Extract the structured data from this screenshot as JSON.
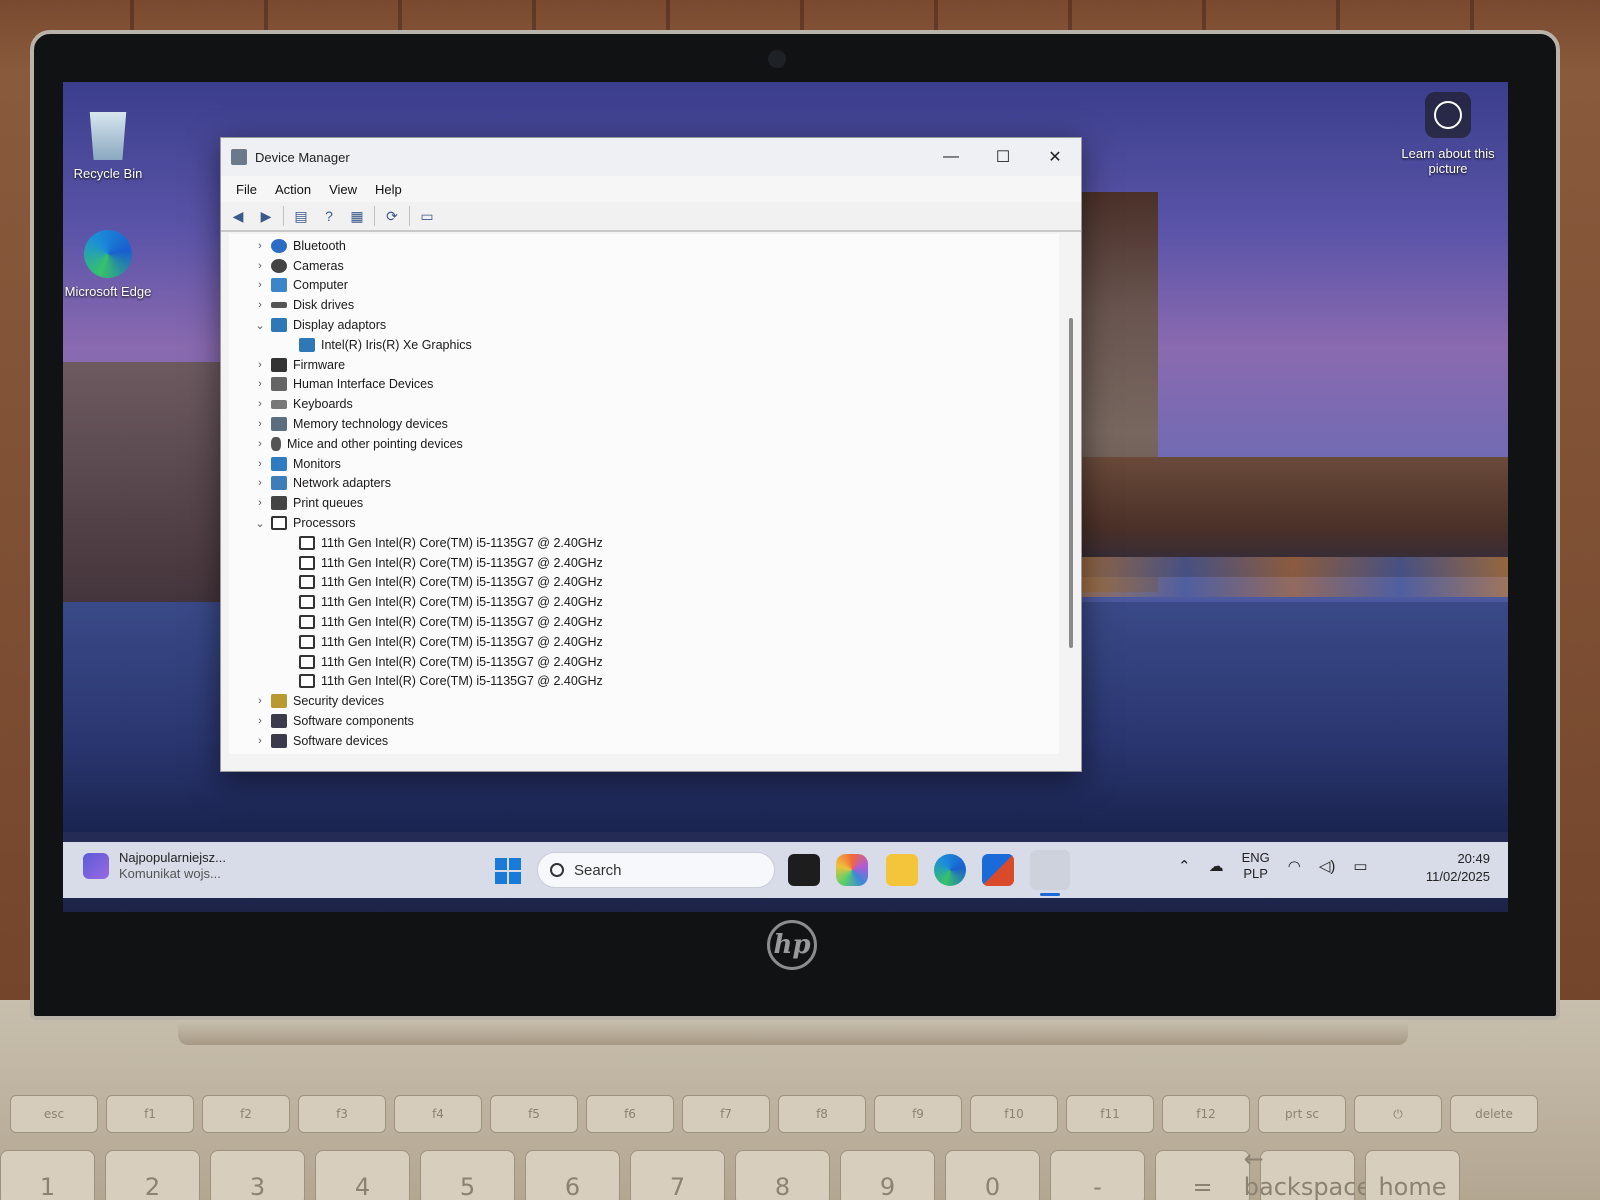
{
  "desktop": {
    "icons": [
      {
        "label": "Recycle Bin"
      },
      {
        "label": "Microsoft Edge"
      }
    ],
    "learn_about": "Learn about this picture"
  },
  "window": {
    "title": "Device Manager",
    "controls": {
      "minimize": "—",
      "maximize": "☐",
      "close": "✕"
    },
    "menu": [
      "File",
      "Action",
      "View",
      "Help"
    ],
    "toolbar": [
      {
        "name": "back-icon",
        "glyph": "◀"
      },
      {
        "name": "forward-icon",
        "glyph": "▶"
      },
      {
        "name": "properties-icon",
        "glyph": "▤"
      },
      {
        "name": "help-icon",
        "glyph": "?"
      },
      {
        "name": "view-icon",
        "glyph": "▦"
      },
      {
        "name": "update-driver-icon",
        "glyph": "⟳"
      },
      {
        "name": "monitor-icon",
        "glyph": "▭"
      }
    ],
    "tree": [
      {
        "label": "Bluetooth",
        "expanded": false,
        "icon": "bluetooth-icon",
        "cls": "ico-bt"
      },
      {
        "label": "Cameras",
        "expanded": false,
        "icon": "camera-icon",
        "cls": "ico-cam"
      },
      {
        "label": "Computer",
        "expanded": false,
        "icon": "computer-icon",
        "cls": "ico-pc"
      },
      {
        "label": "Disk drives",
        "expanded": false,
        "icon": "disk-drive-icon",
        "cls": "ico-disk"
      },
      {
        "label": "Display adaptors",
        "expanded": true,
        "icon": "display-adapter-icon",
        "cls": "ico-disp",
        "children": [
          "Intel(R) Iris(R) Xe Graphics"
        ]
      },
      {
        "label": "Firmware",
        "expanded": false,
        "icon": "firmware-icon",
        "cls": "ico-fw"
      },
      {
        "label": "Human Interface Devices",
        "expanded": false,
        "icon": "hid-icon",
        "cls": "ico-hid"
      },
      {
        "label": "Keyboards",
        "expanded": false,
        "icon": "keyboard-icon",
        "cls": "ico-kb"
      },
      {
        "label": "Memory technology devices",
        "expanded": false,
        "icon": "memory-icon",
        "cls": "ico-mem"
      },
      {
        "label": "Mice and other pointing devices",
        "expanded": false,
        "icon": "mouse-icon",
        "cls": "ico-mouse"
      },
      {
        "label": "Monitors",
        "expanded": false,
        "icon": "monitor-icon",
        "cls": "ico-mon"
      },
      {
        "label": "Network adapters",
        "expanded": false,
        "icon": "network-icon",
        "cls": "ico-net"
      },
      {
        "label": "Print queues",
        "expanded": false,
        "icon": "printer-icon",
        "cls": "ico-print"
      },
      {
        "label": "Processors",
        "expanded": true,
        "icon": "processor-icon",
        "cls": "ico-cpu",
        "children": [
          "11th Gen Intel(R) Core(TM) i5-1135G7 @ 2.40GHz",
          "11th Gen Intel(R) Core(TM) i5-1135G7 @ 2.40GHz",
          "11th Gen Intel(R) Core(TM) i5-1135G7 @ 2.40GHz",
          "11th Gen Intel(R) Core(TM) i5-1135G7 @ 2.40GHz",
          "11th Gen Intel(R) Core(TM) i5-1135G7 @ 2.40GHz",
          "11th Gen Intel(R) Core(TM) i5-1135G7 @ 2.40GHz",
          "11th Gen Intel(R) Core(TM) i5-1135G7 @ 2.40GHz",
          "11th Gen Intel(R) Core(TM) i5-1135G7 @ 2.40GHz"
        ]
      },
      {
        "label": "Security devices",
        "expanded": false,
        "icon": "security-icon",
        "cls": "ico-sec"
      },
      {
        "label": "Software components",
        "expanded": false,
        "icon": "software-component-icon",
        "cls": "ico-sw"
      },
      {
        "label": "Software devices",
        "expanded": false,
        "icon": "software-device-icon",
        "cls": "ico-sw"
      }
    ]
  },
  "taskbar": {
    "widget_title": "Najpopularniejsz...",
    "widget_subtitle": "Komunikat wojs...",
    "search_placeholder": "Search",
    "tray": {
      "lang_top": "ENG",
      "lang_bottom": "PLP"
    },
    "clock": {
      "time": "20:49",
      "date": "11/02/2025"
    }
  },
  "laptop": {
    "brand": "hp"
  },
  "keyboard": {
    "fn_row": [
      "esc",
      "f1",
      "f2",
      "f3",
      "f4",
      "f5",
      "f6",
      "f7",
      "f8",
      "f9",
      "f10",
      "f11",
      "f12",
      "prt sc",
      "⏻",
      "delete"
    ],
    "num_row": [
      "1",
      "2",
      "3",
      "4",
      "5",
      "6",
      "7",
      "8",
      "9",
      "0",
      "-",
      "=",
      "← backspace",
      "home"
    ]
  }
}
